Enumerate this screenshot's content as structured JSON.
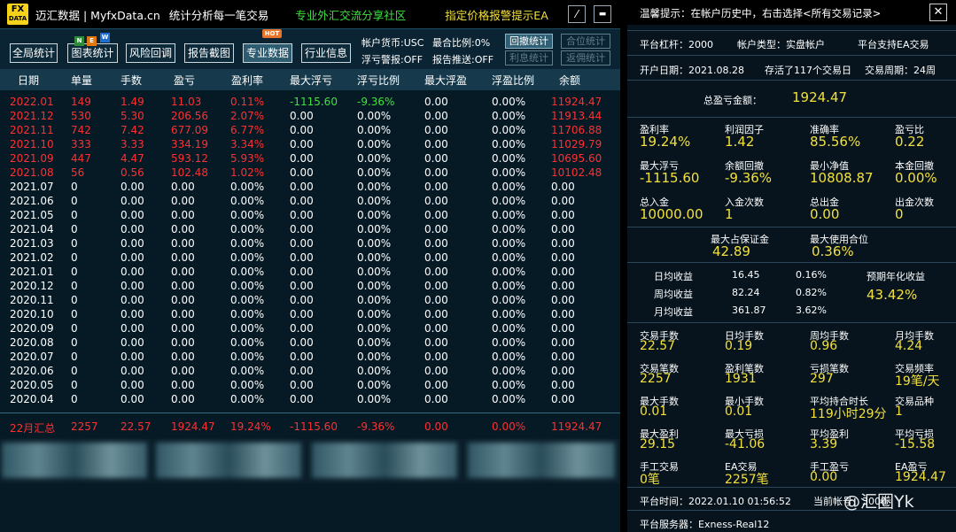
{
  "titlebar": {
    "logo_top": "FX",
    "logo_bottom": "DATA",
    "brand": "迈汇数据 | MyfxData.cn",
    "slogan": "统计分析每一笔交易",
    "community": "专业外汇交流分享社区",
    "ea": "指定价格报警提示EA",
    "min_btn": "⁄",
    "max_btn": "▬"
  },
  "toolbar": {
    "buttons": [
      "全局统计",
      "图表统计",
      "风险回调",
      "报告截图",
      "专业数据",
      "行业信息"
    ],
    "badge_new": [
      "N",
      "E",
      "W"
    ],
    "badge_hot": "HOT",
    "info": [
      "帐户货币:USC",
      "最合比例:0%",
      "浮亏警报:OFF",
      "报告推送:OFF"
    ],
    "small_buttons": [
      "回撤统计",
      "合位统计",
      "利息统计",
      "返佣统计"
    ]
  },
  "table": {
    "headers": [
      "日期",
      "单量",
      "手数",
      "盈亏",
      "盈利率",
      "最大浮亏",
      "浮亏比例",
      "最大浮盈",
      "浮盈比例",
      "余额"
    ],
    "rows": [
      [
        "2022.01",
        "149",
        "1.49",
        "11.03",
        "0.11%",
        "-1115.60",
        "-9.36%",
        "0.00",
        "0.00%",
        "11924.47"
      ],
      [
        "2021.12",
        "530",
        "5.30",
        "206.56",
        "2.07%",
        "0.00",
        "0.00%",
        "0.00",
        "0.00%",
        "11913.44"
      ],
      [
        "2021.11",
        "742",
        "7.42",
        "677.09",
        "6.77%",
        "0.00",
        "0.00%",
        "0.00",
        "0.00%",
        "11706.88"
      ],
      [
        "2021.10",
        "333",
        "3.33",
        "334.19",
        "3.34%",
        "0.00",
        "0.00%",
        "0.00",
        "0.00%",
        "11029.79"
      ],
      [
        "2021.09",
        "447",
        "4.47",
        "593.12",
        "5.93%",
        "0.00",
        "0.00%",
        "0.00",
        "0.00%",
        "10695.60"
      ],
      [
        "2021.08",
        "56",
        "0.56",
        "102.48",
        "1.02%",
        "0.00",
        "0.00%",
        "0.00",
        "0.00%",
        "10102.48"
      ],
      [
        "2021.07",
        "0",
        "0.00",
        "0.00",
        "0.00%",
        "0.00",
        "0.00%",
        "0.00",
        "0.00%",
        "0.00"
      ],
      [
        "2021.06",
        "0",
        "0.00",
        "0.00",
        "0.00%",
        "0.00",
        "0.00%",
        "0.00",
        "0.00%",
        "0.00"
      ],
      [
        "2021.05",
        "0",
        "0.00",
        "0.00",
        "0.00%",
        "0.00",
        "0.00%",
        "0.00",
        "0.00%",
        "0.00"
      ],
      [
        "2021.04",
        "0",
        "0.00",
        "0.00",
        "0.00%",
        "0.00",
        "0.00%",
        "0.00",
        "0.00%",
        "0.00"
      ],
      [
        "2021.03",
        "0",
        "0.00",
        "0.00",
        "0.00%",
        "0.00",
        "0.00%",
        "0.00",
        "0.00%",
        "0.00"
      ],
      [
        "2021.02",
        "0",
        "0.00",
        "0.00",
        "0.00%",
        "0.00",
        "0.00%",
        "0.00",
        "0.00%",
        "0.00"
      ],
      [
        "2021.01",
        "0",
        "0.00",
        "0.00",
        "0.00%",
        "0.00",
        "0.00%",
        "0.00",
        "0.00%",
        "0.00"
      ],
      [
        "2020.12",
        "0",
        "0.00",
        "0.00",
        "0.00%",
        "0.00",
        "0.00%",
        "0.00",
        "0.00%",
        "0.00"
      ],
      [
        "2020.11",
        "0",
        "0.00",
        "0.00",
        "0.00%",
        "0.00",
        "0.00%",
        "0.00",
        "0.00%",
        "0.00"
      ],
      [
        "2020.10",
        "0",
        "0.00",
        "0.00",
        "0.00%",
        "0.00",
        "0.00%",
        "0.00",
        "0.00%",
        "0.00"
      ],
      [
        "2020.09",
        "0",
        "0.00",
        "0.00",
        "0.00%",
        "0.00",
        "0.00%",
        "0.00",
        "0.00%",
        "0.00"
      ],
      [
        "2020.08",
        "0",
        "0.00",
        "0.00",
        "0.00%",
        "0.00",
        "0.00%",
        "0.00",
        "0.00%",
        "0.00"
      ],
      [
        "2020.07",
        "0",
        "0.00",
        "0.00",
        "0.00%",
        "0.00",
        "0.00%",
        "0.00",
        "0.00%",
        "0.00"
      ],
      [
        "2020.06",
        "0",
        "0.00",
        "0.00",
        "0.00%",
        "0.00",
        "0.00%",
        "0.00",
        "0.00%",
        "0.00"
      ],
      [
        "2020.05",
        "0",
        "0.00",
        "0.00",
        "0.00%",
        "0.00",
        "0.00%",
        "0.00",
        "0.00%",
        "0.00"
      ],
      [
        "2020.04",
        "0",
        "0.00",
        "0.00",
        "0.00%",
        "0.00",
        "0.00%",
        "0.00",
        "0.00%",
        "0.00"
      ]
    ],
    "summary": [
      "22月汇总",
      "2257",
      "22.57",
      "1924.47",
      "19.24%",
      "-1115.60",
      "-9.36%",
      "0.00",
      "0.00%",
      "11924.47"
    ]
  },
  "colors": {
    "red": "#ff3030",
    "green": "#3de33d",
    "yellow": "#f2e03c",
    "white": "#ffffff"
  },
  "right": {
    "hint": "温馨提示：在帐户历史中，右击选择<所有交易记录>",
    "close": "✕",
    "leverage": "平台杠杆：2000",
    "acct_type": "帐户类型：实盘帐户",
    "ea_support": "平台支持EA交易",
    "open_date": "开户日期：2021.08.28",
    "alive": "存活了117个交易日",
    "cycle": "交易周期：24周",
    "total_pl_label": "总盈亏金额：",
    "total_pl": "1924.47",
    "g1": [
      {
        "l": "盈利率",
        "v": "19.24%"
      },
      {
        "l": "利润因子",
        "v": "1.42"
      },
      {
        "l": "准确率",
        "v": "85.56%"
      },
      {
        "l": "盈亏比",
        "v": "0.22"
      },
      {
        "l": "最大浮亏",
        "v": "-1115.60"
      },
      {
        "l": "余额回撤",
        "v": "-9.36%"
      },
      {
        "l": "最小净值",
        "v": "10808.87"
      },
      {
        "l": "本金回撤",
        "v": "0.00%"
      },
      {
        "l": "总入金",
        "v": "10000.00"
      },
      {
        "l": "入金次数",
        "v": "1"
      },
      {
        "l": "总出金",
        "v": "0.00"
      },
      {
        "l": "出金次数",
        "v": "0"
      }
    ],
    "margin_label": "最大占保证金",
    "margin": "42.89",
    "usage_label": "最大使用合位",
    "usage": "0.36%",
    "daily": [
      {
        "l": "日均收益",
        "v": "16.45",
        "p": "0.16%"
      },
      {
        "l": "周均收益",
        "v": "82.24",
        "p": "0.82%"
      },
      {
        "l": "月均收益",
        "v": "361.87",
        "p": "3.62%"
      }
    ],
    "annual_label": "预期年化收益",
    "annual": "43.42%",
    "g2": [
      {
        "l": "交易手数",
        "v": "22.57"
      },
      {
        "l": "日均手数",
        "v": "0.19"
      },
      {
        "l": "周均手数",
        "v": "0.96"
      },
      {
        "l": "月均手数",
        "v": "4.24"
      },
      {
        "l": "交易笔数",
        "v": "2257"
      },
      {
        "l": "盈利笔数",
        "v": "1931"
      },
      {
        "l": "亏损笔数",
        "v": "297"
      },
      {
        "l": "交易频率",
        "v": "19笔/天"
      },
      {
        "l": "最大手数",
        "v": "0.01"
      },
      {
        "l": "最小手数",
        "v": "0.01"
      },
      {
        "l": "平均持合时长",
        "v": "119小时29分"
      },
      {
        "l": "交易品种",
        "v": "1"
      },
      {
        "l": "最大盈利",
        "v": "29.15"
      },
      {
        "l": "最大亏损",
        "v": "-41.06"
      },
      {
        "l": "平均盈利",
        "v": "3.39"
      },
      {
        "l": "平均亏损",
        "v": "-15.58"
      },
      {
        "l": "手工交易",
        "v": "0笔"
      },
      {
        "l": "EA交易",
        "v": "2257笔"
      },
      {
        "l": "手工盈亏",
        "v": "0.00"
      },
      {
        "l": "EA盈亏",
        "v": "1924.47"
      }
    ],
    "platform_time": "平台时间：2022.01.10 01:56:52",
    "current": "当前帐号：3000",
    "server": "平台服务器：Exness-Real12"
  },
  "watermark": "@汇圈Yk"
}
